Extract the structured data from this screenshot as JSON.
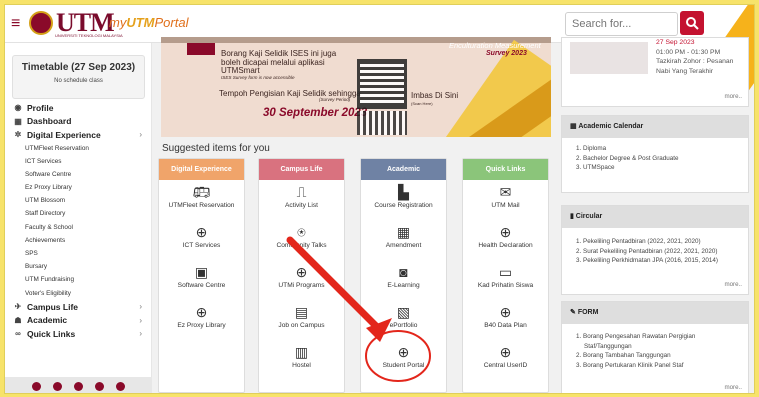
{
  "header": {
    "logo_text": "UTM",
    "logo_tagline": "UNIVERSITI TEKNOLOGI MALAYSIA",
    "portal_name_prefix": "my",
    "portal_name_brand": "UTM",
    "portal_name_suffix": "Portal",
    "search_placeholder": "Search for..."
  },
  "timetable": {
    "title": "Timetable (27 Sep 2023)",
    "status": "No schedule class"
  },
  "sidebar": {
    "items": [
      {
        "label": "Profile",
        "icon": "profile-icon"
      },
      {
        "label": "Dashboard",
        "icon": "dashboard-icon"
      },
      {
        "label": "Digital Experience",
        "icon": "digital-experience-icon"
      }
    ],
    "digital_sub": [
      "UTMFleet Reservation",
      "ICT Services",
      "Software Centre",
      "Ez Proxy Library",
      "UTM Blossom",
      "Staff Directory",
      "Faculty & School",
      "Achievements",
      "SPS",
      "Bursary",
      "UTM Fundraising",
      "Voter's Eligibility"
    ],
    "bottom_items": [
      {
        "label": "Campus Life",
        "icon": "campus-life-icon"
      },
      {
        "label": "Academic",
        "icon": "academic-icon"
      },
      {
        "label": "Quick Links",
        "icon": "quick-links-icon"
      }
    ]
  },
  "banner": {
    "line1": "Borang Kaji Selidik ISES ini juga boleh dicapai melalui aplikasi UTMSmart",
    "line2": "ISES Survey form is now accessible",
    "line3": "Tempoh Pengisian Kaji Selidik sehingga",
    "line4": "(Survey Period)",
    "date": "30 September 2023",
    "scan": "Imbas Di Sini",
    "scan_en": "(Scan Here)",
    "top_right": "Enculturation Measurement",
    "survey": "Survey 2023"
  },
  "suggested_title": "Suggested items for you",
  "columns": [
    {
      "title": "Digital Experience",
      "color": "#f0a46a",
      "items": [
        {
          "label": "UTMFleet Reservation",
          "icon": "bus-icon"
        },
        {
          "label": "ICT Services",
          "icon": "globe-icon"
        },
        {
          "label": "Software Centre",
          "icon": "monitor-icon"
        },
        {
          "label": "Ez Proxy Library",
          "icon": "globe-icon"
        }
      ]
    },
    {
      "title": "Campus Life",
      "color": "#d9727f",
      "items": [
        {
          "label": "Activity List",
          "icon": "chart-icon"
        },
        {
          "label": "Community Talks",
          "icon": "community-icon"
        },
        {
          "label": "UTMi Programs",
          "icon": "globe-icon"
        },
        {
          "label": "Job on Campus",
          "icon": "briefcase-icon"
        },
        {
          "label": "Hostel",
          "icon": "building-icon"
        }
      ]
    },
    {
      "title": "Academic",
      "color": "#6f82a4",
      "items": [
        {
          "label": "Course Registration",
          "icon": "trash-icon"
        },
        {
          "label": "Amendment",
          "icon": "calendar-icon"
        },
        {
          "label": "E-Learning",
          "icon": "elearning-icon"
        },
        {
          "label": "ePortfolio",
          "icon": "book-icon"
        },
        {
          "label": "Student Portal",
          "icon": "globe-icon"
        }
      ]
    },
    {
      "title": "Quick Links",
      "color": "#8bc57a",
      "items": [
        {
          "label": "UTM Mail",
          "icon": "mail-icon"
        },
        {
          "label": "Health Declaration",
          "icon": "globe-icon"
        },
        {
          "label": "Kad Prihatin Siswa",
          "icon": "card-icon"
        },
        {
          "label": "B40 Data Plan",
          "icon": "globe-icon"
        },
        {
          "label": "Central UserID",
          "icon": "globe-icon"
        }
      ]
    }
  ],
  "news": {
    "date": "27 Sep 2023",
    "time": "01:00 PM - 01:30 PM",
    "line1": "Tazkirah Zohor : Pesanan",
    "line2": "Nabi Yang Terakhir",
    "more": "more.."
  },
  "academic_calendar": {
    "title": "Academic Calendar",
    "items": [
      "1. Diploma",
      "2. Bachelor Degree & Post Graduate",
      "3. UTMSpace"
    ]
  },
  "circular": {
    "title": "Circular",
    "items": [
      "1. Pekeliling Pentadbiran (2022, 2021, 2020)",
      "2. Surat Pekeliling Pentadbiran (2022, 2021, 2020)",
      "3. Pekeliling Perkhidmatan JPA (2016, 2015, 2014)"
    ],
    "more": "more.."
  },
  "form": {
    "title": "FORM",
    "items": [
      "1. Borang Pengesahan Rawatan Pergigian",
      "Staf/Tanggungan",
      "2. Borang Tambahan Tanggungan",
      "3. Borang Pertukaran Klinik Panel Staf"
    ],
    "more": "more.."
  }
}
